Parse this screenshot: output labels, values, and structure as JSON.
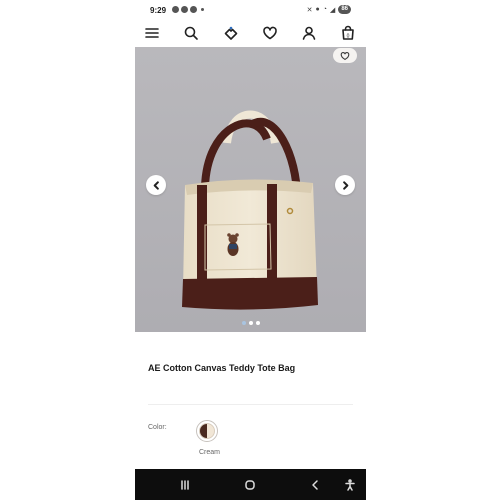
{
  "status_bar": {
    "time": "9:29",
    "battery": "86",
    "notification_icons": [
      "message-icon",
      "chat-icon",
      "chat-icon"
    ],
    "system_icons": [
      "mute-icon",
      "location-icon",
      "wifi-icon",
      "signal-icon",
      "battery-icon"
    ]
  },
  "nav": {
    "icons": [
      "menu-icon",
      "search-icon",
      "offers-tag-icon",
      "favorites-heart-icon",
      "account-icon",
      "shopping-bag-icon"
    ],
    "bag_count": "0"
  },
  "product": {
    "title": "AE Cotton Canvas Teddy Tote Bag",
    "gallery": {
      "image_count": 3,
      "active_index": 0,
      "colors": {
        "bag_canvas": "#ede4cf",
        "bag_trim": "#4b1f19",
        "background": "#b5b4b8"
      }
    },
    "color": {
      "label": "Color:",
      "selected": "Cream",
      "swatch_colors": [
        "#4a2a20",
        "#f1e6d6"
      ]
    }
  },
  "system_nav": {
    "icons": [
      "recents-icon",
      "home-icon",
      "back-icon",
      "accessibility-icon"
    ]
  }
}
